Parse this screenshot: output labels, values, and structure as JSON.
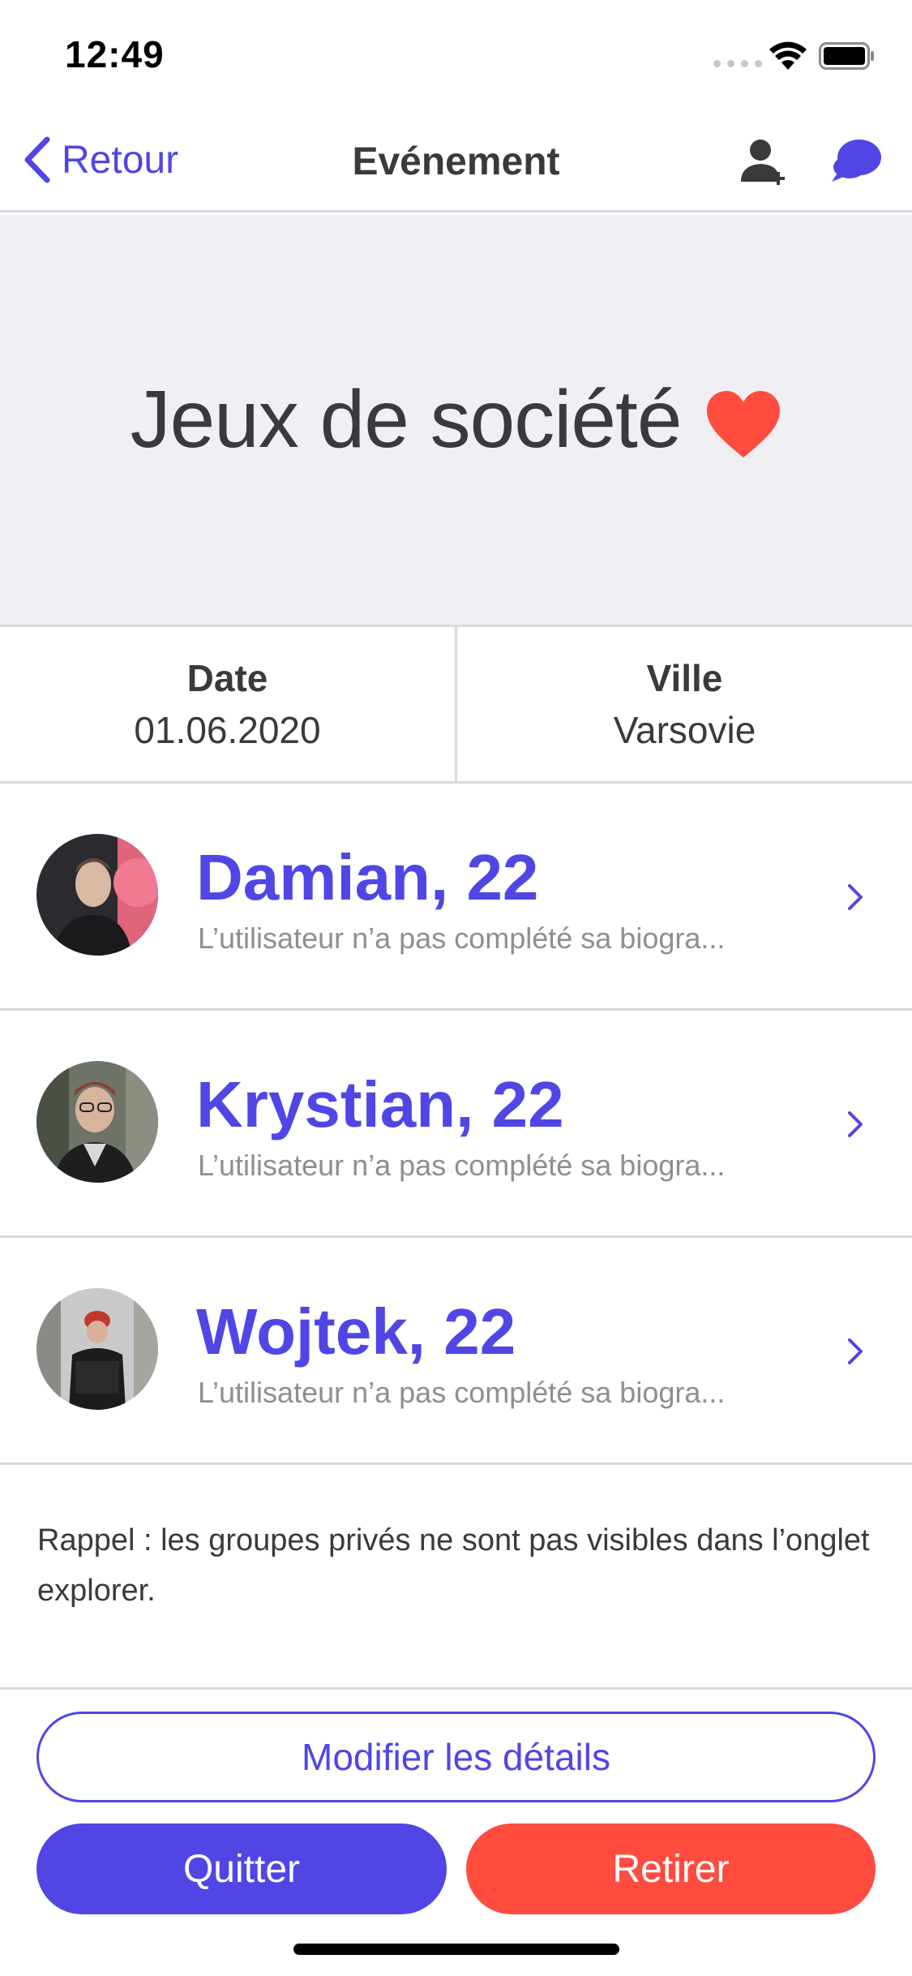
{
  "status_bar": {
    "time": "12:49"
  },
  "nav": {
    "back_label": "Retour",
    "title": "Evénement",
    "accent_color": "#5046e5"
  },
  "event": {
    "title": "Jeux de société",
    "heart_color": "#ff4c3f"
  },
  "info": {
    "date_label": "Date",
    "date_value": "01.06.2020",
    "city_label": "Ville",
    "city_value": "Varsovie"
  },
  "members": [
    {
      "name": "Damian, 22",
      "bio": "L’utilisateur n’a pas complété sa biogra..."
    },
    {
      "name": "Krystian, 22",
      "bio": "L’utilisateur n’a pas complété sa biogra..."
    },
    {
      "name": "Wojtek, 22",
      "bio": "L’utilisateur n’a pas complété sa biogra..."
    }
  ],
  "note": "Rappel : les groupes privés ne sont pas visibles dans l’onglet explorer.",
  "actions": {
    "edit_label": "Modifier les détails",
    "leave_label": "Quitter",
    "remove_label": "Retirer",
    "leave_color": "#5046e5",
    "remove_color": "#ff4c3f"
  }
}
